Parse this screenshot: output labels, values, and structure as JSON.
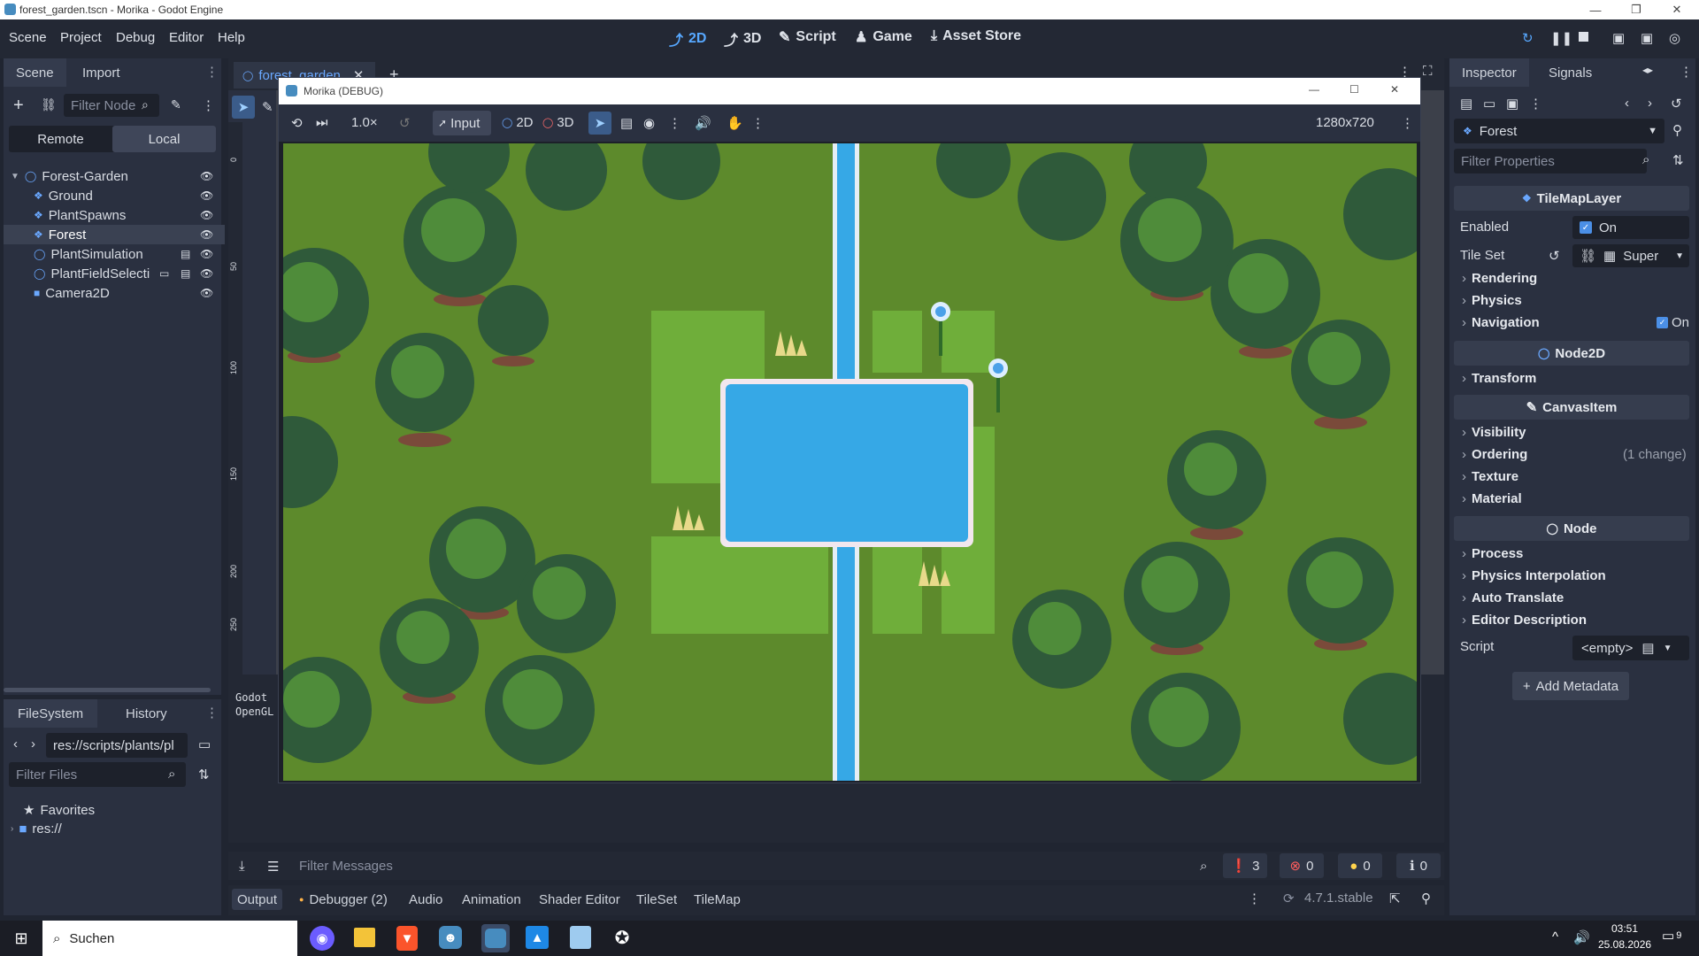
{
  "window": {
    "title": "forest_garden.tscn - Morika - Godot Engine"
  },
  "menu": [
    "Scene",
    "Project",
    "Debug",
    "Editor",
    "Help"
  ],
  "main_buttons": [
    {
      "label": "2D",
      "icon": "2d-icon",
      "active": true
    },
    {
      "label": "3D",
      "icon": "3d-icon",
      "active": false
    },
    {
      "label": "Script",
      "icon": "script-icon",
      "active": false
    },
    {
      "label": "Game",
      "icon": "game-icon",
      "active": false
    },
    {
      "label": "Asset Store",
      "icon": "asset-store-icon",
      "active": false
    }
  ],
  "scene_dock": {
    "tabs": [
      "Scene",
      "Import"
    ],
    "filter_placeholder": "Filter Node",
    "remote_label": "Remote",
    "local_label": "Local",
    "tree": [
      {
        "label": "Forest-Garden",
        "icon": "node-icon",
        "indent": 0,
        "selected": false
      },
      {
        "label": "Ground",
        "icon": "tilemap-icon",
        "indent": 1,
        "selected": false
      },
      {
        "label": "PlantSpawns",
        "icon": "tilemap-icon",
        "indent": 1,
        "selected": false
      },
      {
        "label": "Forest",
        "icon": "tilemap-icon",
        "indent": 1,
        "selected": true
      },
      {
        "label": "PlantSimulation",
        "icon": "node-icon",
        "indent": 1,
        "selected": false
      },
      {
        "label": "PlantFieldSelecti",
        "icon": "node-icon",
        "indent": 1,
        "selected": false
      },
      {
        "label": "Camera2D",
        "icon": "camera-icon",
        "indent": 1,
        "selected": false
      }
    ]
  },
  "filesystem": {
    "tabs": [
      "FileSystem",
      "History"
    ],
    "path": "res://scripts/plants/pl",
    "filter_placeholder": "Filter Files",
    "items": [
      "Favorites",
      "res://"
    ]
  },
  "scene_tab": {
    "label": "forest_garden"
  },
  "ruler_labels": [
    "0",
    "50",
    "100",
    "150",
    "200",
    "250"
  ],
  "game_window": {
    "title": "Morika (DEBUG)",
    "zoom": "1.0×",
    "input_label": "Input",
    "mode_2d": "2D",
    "mode_3d": "3D",
    "resolution": "1280x720"
  },
  "output_preview": [
    "Godot",
    "OpenGL"
  ],
  "inspector": {
    "tabs": [
      "Inspector",
      "Signals"
    ],
    "node_name": "Forest",
    "filter_placeholder": "Filter Properties",
    "class_tilemaplayer": "TileMapLayer",
    "enabled_label": "Enabled",
    "enabled_value": "On",
    "tileset_label": "Tile Set",
    "tileset_value": "Super",
    "groups_tml": [
      "Rendering",
      "Physics",
      "Navigation"
    ],
    "navigation_value": "On",
    "class_node2d": "Node2D",
    "groups_node2d": [
      "Transform"
    ],
    "class_canvasitem": "CanvasItem",
    "groups_canvasitem": [
      "Visibility",
      "Ordering",
      "Texture",
      "Material"
    ],
    "ordering_note": "(1 change)",
    "class_node": "Node",
    "groups_node": [
      "Process",
      "Physics Interpolation",
      "Auto Translate",
      "Editor Description"
    ],
    "script_label": "Script",
    "script_value": "<empty>",
    "add_metadata": "Add Metadata"
  },
  "bottom": {
    "filter_placeholder": "Filter Messages",
    "counts": {
      "messages": "3",
      "errors": "0",
      "warnings": "0",
      "info": "0"
    },
    "tabs": [
      "Output",
      "Debugger (2)",
      "Audio",
      "Animation",
      "Shader Editor",
      "TileSet",
      "TileMap"
    ],
    "version": "4.7.1.stable"
  },
  "taskbar": {
    "search_placeholder": "Suchen",
    "time": "03:51",
    "date": "25.08.2026",
    "notifications": "9"
  },
  "colors": {
    "accent": "#57a8ff",
    "panel": "#2a3040",
    "bg": "#202531",
    "grass": "#5d8a2c",
    "water": "#36a8e6"
  }
}
